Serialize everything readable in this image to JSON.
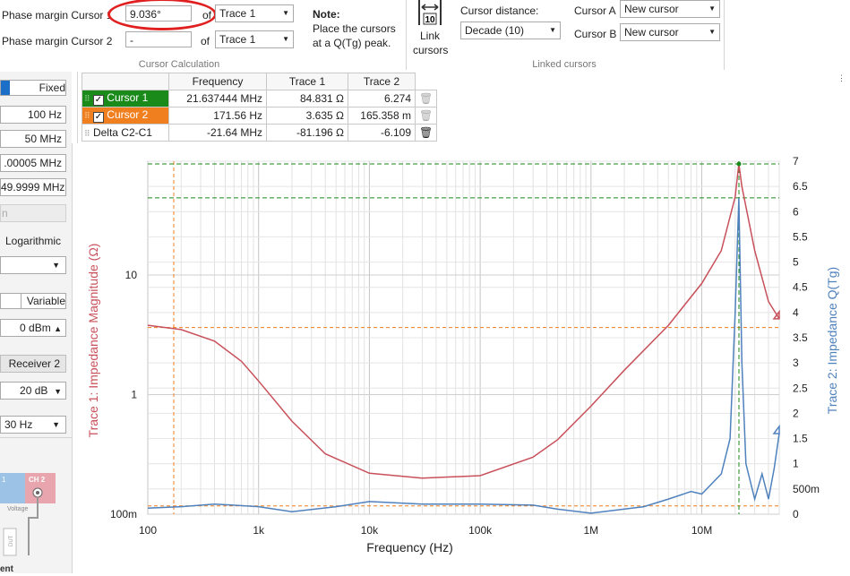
{
  "ribbon": {
    "phase_margin_1_label": "Phase margin Cursor 1",
    "phase_margin_1_value": "9.036°",
    "phase_margin_2_label": "Phase margin Cursor 2",
    "phase_margin_2_value": "-",
    "of_label": "of",
    "trace_select_1": "Trace 1",
    "trace_select_2": "Trace 1",
    "note_title": "Note:",
    "note_line1": "Place the cursors",
    "note_line2": "at a Q(Tg) peak.",
    "cursor_calc_group": "Cursor Calculation",
    "link_cursors_line1": "Link",
    "link_cursors_line2": "cursors",
    "link_icon_text": "10",
    "cursor_distance_label": "Cursor distance:",
    "cursor_distance_value": "Decade (10)",
    "cursor_a_label": "Cursor A",
    "cursor_a_value": "New cursor",
    "cursor_b_label": "Cursor B",
    "cursor_b_value": "New cursor",
    "linked_cursors_group": "Linked cursors"
  },
  "left_panel": {
    "sweep_fixed": "Fixed",
    "start_freq": "100 Hz",
    "stop_freq": "50 MHz",
    "field3": ".00005 MHz",
    "field4": "49.9999 MHz",
    "disabled_btn": "n",
    "sweep_type": "Logarithmic",
    "variable_label": "Variable",
    "level": "0 dBm",
    "receiver2": "Receiver 2",
    "attenuation": "20 dB",
    "bandwidth": "30 Hz",
    "ch1": "1",
    "ch2": "CH 2",
    "voltage": "Voltage",
    "dut": "DUT",
    "bottom_partial": "ent"
  },
  "cursor_table": {
    "headers": [
      "",
      "Frequency",
      "Trace 1",
      "Trace 2"
    ],
    "rows": [
      {
        "name": "Cursor 1",
        "freq": "21.637444 MHz",
        "t1": "84.831 Ω",
        "t2": "6.274",
        "color": "#1a8a1a"
      },
      {
        "name": "Cursor 2",
        "freq": "171.56 Hz",
        "t1": "3.635 Ω",
        "t2": "165.358 m",
        "color": "#f07f1f"
      },
      {
        "name": "Delta C2-C1",
        "freq": "-21.64 MHz",
        "t1": "-81.196 Ω",
        "t2": "-6.109",
        "color": "#ffffff"
      }
    ]
  },
  "chart_data": {
    "type": "line",
    "xlabel": "Frequency (Hz)",
    "ylabel_left": "Trace 1: Impedance Magnitude (Ω)",
    "ylabel_right": "Trace 2: Impedance Q(Tg)",
    "x_scale": "log",
    "xlim": [
      100,
      50000000
    ],
    "x_ticks": [
      "100",
      "1k",
      "10k",
      "100k",
      "1M",
      "10M"
    ],
    "y_left_scale": "log",
    "y_left_ticks": [
      "100m",
      "1",
      "10"
    ],
    "y_right_ticks": [
      "0",
      "500m",
      "1",
      "1.5",
      "2",
      "2.5",
      "3",
      "3.5",
      "4",
      "4.5",
      "5",
      "5.5",
      "6",
      "6.5",
      "7"
    ],
    "ylim_right": [
      0,
      7
    ],
    "grid": true,
    "colors": {
      "trace1": "#c8505a",
      "trace2": "#4f81bd",
      "cursor1": "#1a8a1a",
      "cursor2": "#f07f1f"
    },
    "series": [
      {
        "name": "Trace 1",
        "axis": "left",
        "x": [
          100,
          200,
          400,
          700,
          1000,
          2000,
          4000,
          10000,
          30000,
          100000,
          300000,
          500000,
          1000000,
          2000000,
          5000000,
          10000000,
          15000000,
          20000000,
          21600000,
          23000000,
          30000000,
          40000000,
          50000000
        ],
        "values": [
          3.8,
          3.5,
          2.8,
          1.9,
          1.3,
          0.6,
          0.32,
          0.22,
          0.2,
          0.21,
          0.3,
          0.42,
          0.8,
          1.6,
          3.8,
          8.5,
          16,
          45,
          85,
          55,
          16,
          6,
          4.3
        ]
      },
      {
        "name": "Trace 2",
        "axis": "right",
        "x": [
          100,
          200,
          400,
          1000,
          2000,
          5000,
          10000,
          30000,
          100000,
          300000,
          500000,
          1000000,
          3000000,
          5000000,
          8000000,
          10000000,
          15000000,
          18000000,
          20000000,
          21600000,
          23000000,
          25000000,
          30000000,
          35000000,
          40000000,
          45000000,
          50000000
        ],
        "values": [
          0.12,
          0.15,
          0.2,
          0.15,
          0.05,
          0.15,
          0.25,
          0.2,
          0.2,
          0.18,
          0.1,
          0.02,
          0.15,
          0.3,
          0.45,
          0.4,
          0.8,
          1.5,
          4.0,
          6.27,
          3.0,
          1.0,
          0.3,
          0.8,
          0.3,
          0.9,
          1.6
        ]
      }
    ],
    "cursors": [
      {
        "name": "Cursor 1",
        "x": 21637444,
        "y_right": 6.274
      },
      {
        "name": "Cursor 2",
        "x": 171.56,
        "y_left": 3.635
      }
    ]
  }
}
